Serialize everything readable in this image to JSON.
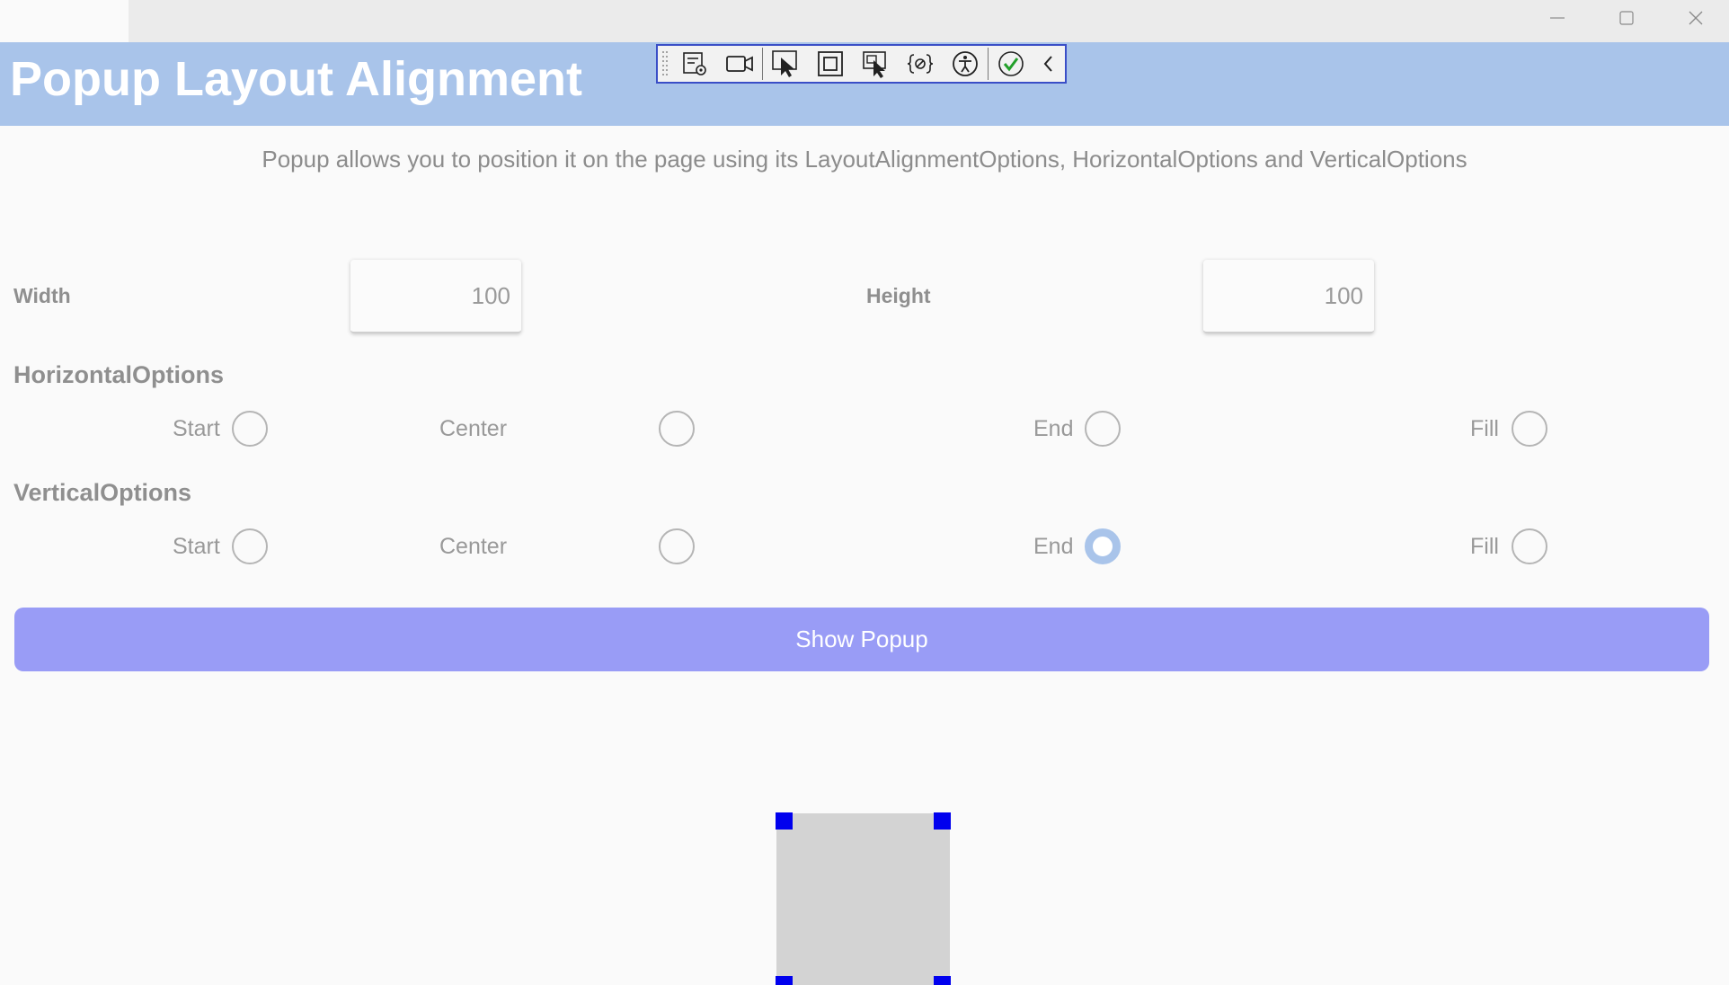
{
  "window": {
    "icons": {
      "minimize": "minimize-icon",
      "maximize": "maximize-icon",
      "close": "close-icon"
    }
  },
  "header": {
    "title": "Popup Layout Alignment"
  },
  "devtools": {
    "tools": [
      "grip-icon",
      "live-visual-tree-icon",
      "record-icon",
      "select-element-icon",
      "display-layout-adorners-icon",
      "track-focus-icon",
      "binding-failures-icon",
      "accessibility-icon",
      "checkmark-icon",
      "collapse-chevron-icon"
    ]
  },
  "description": "Popup allows you to position it on the page using its LayoutAlignmentOptions, HorizontalOptions and VerticalOptions",
  "size": {
    "width_label": "Width",
    "width_value": "100",
    "height_label": "Height",
    "height_value": "100"
  },
  "horizontal": {
    "title": "HorizontalOptions",
    "options": [
      "Start",
      "Center",
      "End",
      "Fill"
    ],
    "selected": null
  },
  "vertical": {
    "title": "VerticalOptions",
    "options": [
      "Start",
      "Center",
      "End",
      "Fill"
    ],
    "selected": "End"
  },
  "actions": {
    "show_popup": "Show Popup"
  },
  "colors": {
    "header": "#a9c4ea",
    "button": "#999cf6",
    "radio_selected": "#a9c4ea",
    "popup_fill": "#d3d3d3",
    "selection_handle": "#0000ee"
  }
}
